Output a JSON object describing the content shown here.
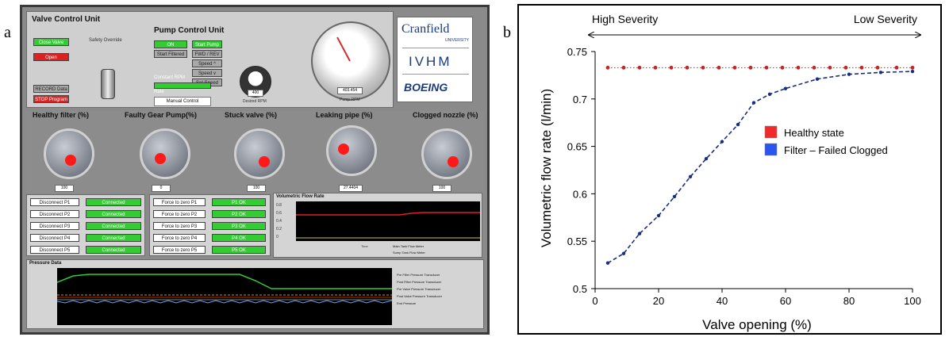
{
  "panel_labels": {
    "a": "a",
    "b": "b"
  },
  "valve_control": {
    "title": "Valve Control Unit",
    "close_valve": "Close Valve",
    "open": "Open",
    "safety_override": "Safety Override",
    "record_data": "RECORD Data",
    "stop_program": "STOP Program"
  },
  "pump_control": {
    "title": "Pump Control Unit",
    "on": "ON",
    "start_filtered": "Start Filtered",
    "start_pump": "Start Pump",
    "fwd_rev": "FWD / REV",
    "speed_up": "Speed ^",
    "speed_down": "Speed v",
    "set_speed": "Set Speed",
    "constant_rpm": "Constant RPM",
    "rate": "Rate",
    "manual_control": "Manual Control",
    "desired_rpm": "Desired RPM",
    "desired_value": "400",
    "pump_rpm": "Pump RPM",
    "pump_value": "403.454"
  },
  "logos": {
    "cranfield": "Cranfield",
    "university": "UNIVERSITY",
    "ivhm": "IVHM",
    "boeing": "BOEING"
  },
  "knobs": [
    {
      "label": "Healthy filter (%)",
      "value": "100"
    },
    {
      "label": "Faulty Gear Pump(%)",
      "value": "0"
    },
    {
      "label": "Stuck valve (%)",
      "value": "100"
    },
    {
      "label": "Leaking pipe (%)",
      "value": "27.4404"
    },
    {
      "label": "Clogged nozzle (%)",
      "value": "100"
    }
  ],
  "disconnect_buttons": [
    "Disconnect P1",
    "Disconnect P2",
    "Disconnect P3",
    "Disconnect P4",
    "Disconnect P5"
  ],
  "disconnect_status": "Connected",
  "zero_buttons": [
    "Force to zero P1",
    "Force to zero P2",
    "Force to zero P3",
    "Force to zero P4",
    "Force to zero P5"
  ],
  "zero_status": [
    "P1 OK",
    "P2 OK",
    "P3 OK",
    "P4 OK",
    "P5 OK"
  ],
  "flow_chart": {
    "title": "Volumetric Flow Rate",
    "yticks": [
      "0.8",
      "0.6",
      "0.4",
      "0.2",
      "0"
    ],
    "legend": [
      "Main Tank Flow Meter",
      "Sump Tank Flow Meter"
    ],
    "xlabel": "Time"
  },
  "pressure_chart": {
    "title": "Pressure Data",
    "legend": [
      "Pre Filter Pressure Transducer",
      "Post Filter Pressure Transducer",
      "Pre Valve Pressure Transducer",
      "Post Valve Pressure Transducer",
      "End Pressure"
    ]
  },
  "chart_data": {
    "type": "line",
    "annotations": {
      "left": "High Severity",
      "right": "Low Severity"
    },
    "xlabel": "Valve opening (%)",
    "ylabel": "Volumetric flow rate (l/min)",
    "xlim": [
      0,
      100
    ],
    "ylim": [
      0.5,
      0.75
    ],
    "xticks": [
      0,
      20,
      40,
      60,
      80,
      100
    ],
    "yticks": [
      0.5,
      0.55,
      0.6,
      0.65,
      0.7,
      0.75
    ],
    "legend_position": "right-middle",
    "series": [
      {
        "name": "Healthy state",
        "color": "#cc2222",
        "style": "dotted",
        "x": [
          4,
          9,
          14,
          19,
          24,
          29,
          34,
          39,
          44,
          49,
          54,
          59,
          64,
          69,
          74,
          79,
          84,
          89,
          95,
          100
        ],
        "y": [
          0.733,
          0.733,
          0.733,
          0.733,
          0.733,
          0.733,
          0.733,
          0.733,
          0.733,
          0.733,
          0.733,
          0.733,
          0.733,
          0.733,
          0.733,
          0.733,
          0.733,
          0.733,
          0.733,
          0.733
        ]
      },
      {
        "name": "Filter – Failed Clogged",
        "color": "#1a2f80",
        "style": "dashed",
        "x": [
          4,
          9,
          14,
          20,
          25,
          30,
          35,
          40,
          45,
          50,
          55,
          60,
          70,
          80,
          90,
          100
        ],
        "y": [
          0.527,
          0.537,
          0.558,
          0.577,
          0.597,
          0.618,
          0.637,
          0.655,
          0.673,
          0.696,
          0.705,
          0.711,
          0.721,
          0.726,
          0.728,
          0.729
        ]
      }
    ]
  }
}
